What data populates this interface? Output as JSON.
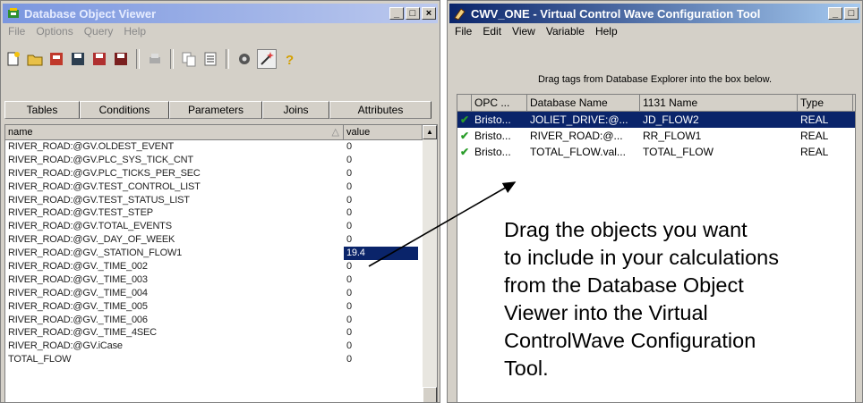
{
  "left_window": {
    "title": "Database Object Viewer",
    "menu": [
      "File",
      "Options",
      "Query",
      "Help"
    ],
    "tabs": [
      "Tables",
      "Conditions",
      "Parameters",
      "Joins",
      "Attributes"
    ],
    "columns": {
      "name": "name",
      "value": "value"
    },
    "rows": [
      {
        "name": "RIVER_ROAD:@GV.OLDEST_EVENT",
        "value": "0"
      },
      {
        "name": "RIVER_ROAD:@GV.PLC_SYS_TICK_CNT",
        "value": "0"
      },
      {
        "name": "RIVER_ROAD:@GV.PLC_TICKS_PER_SEC",
        "value": "0"
      },
      {
        "name": "RIVER_ROAD:@GV.TEST_CONTROL_LIST",
        "value": "0"
      },
      {
        "name": "RIVER_ROAD:@GV.TEST_STATUS_LIST",
        "value": "0"
      },
      {
        "name": "RIVER_ROAD:@GV.TEST_STEP",
        "value": "0"
      },
      {
        "name": "RIVER_ROAD:@GV.TOTAL_EVENTS",
        "value": "0"
      },
      {
        "name": "RIVER_ROAD:@GV._DAY_OF_WEEK",
        "value": "0"
      },
      {
        "name": "RIVER_ROAD:@GV._STATION_FLOW1",
        "value": "19.4"
      },
      {
        "name": "RIVER_ROAD:@GV._TIME_002",
        "value": "0"
      },
      {
        "name": "RIVER_ROAD:@GV._TIME_003",
        "value": "0"
      },
      {
        "name": "RIVER_ROAD:@GV._TIME_004",
        "value": "0"
      },
      {
        "name": "RIVER_ROAD:@GV._TIME_005",
        "value": "0"
      },
      {
        "name": "RIVER_ROAD:@GV._TIME_006",
        "value": "0"
      },
      {
        "name": "RIVER_ROAD:@GV._TIME_4SEC",
        "value": "0"
      },
      {
        "name": "RIVER_ROAD:@GV.iCase",
        "value": "0"
      },
      {
        "name": "TOTAL_FLOW",
        "value": "0"
      }
    ]
  },
  "right_window": {
    "title": "CWV_ONE - Virtual Control Wave Configuration Tool",
    "menu": [
      "File",
      "Edit",
      "View",
      "Variable",
      "Help"
    ],
    "hint": "Drag tags from Database Explorer into the box below.",
    "columns": {
      "opc": "OPC ...",
      "db": "Database Name",
      "name1131": "1131 Name",
      "type": "Type"
    },
    "rows": [
      {
        "opc": "Bristo...",
        "db": "JOLIET_DRIVE:@...",
        "name1131": "JD_FLOW2",
        "type": "REAL"
      },
      {
        "opc": "Bristo...",
        "db": "RIVER_ROAD:@...",
        "name1131": "RR_FLOW1",
        "type": "REAL"
      },
      {
        "opc": "Bristo...",
        "db": "TOTAL_FLOW.val...",
        "name1131": "TOTAL_FLOW",
        "type": "REAL"
      }
    ]
  },
  "callout_lines": [
    "Drag the objects you want",
    "to include in your calculations",
    "from the Database Object",
    "Viewer into the Virtual",
    "ControlWave Configuration",
    "Tool."
  ],
  "colors": {
    "selection": "#0a246a",
    "check": "#2a9d2a",
    "window_bg": "#d4d0c8"
  }
}
